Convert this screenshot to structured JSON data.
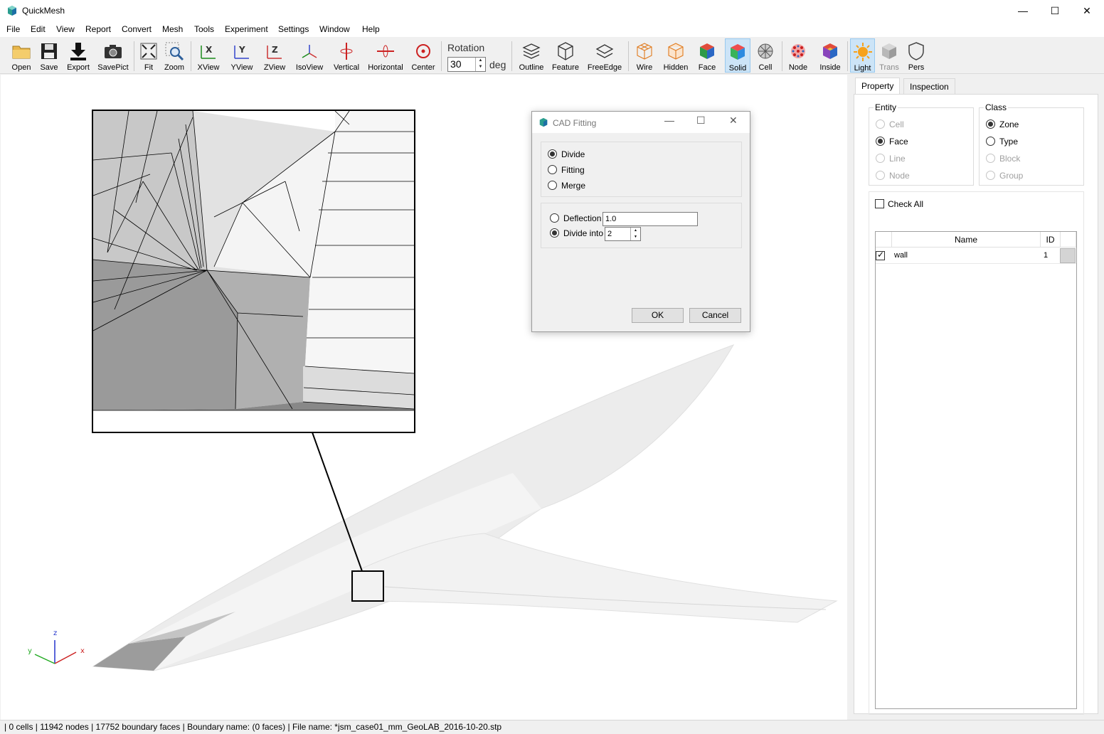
{
  "app": {
    "title": "QuickMesh"
  },
  "menu": [
    "File",
    "Edit",
    "View",
    "Report",
    "Convert",
    "Mesh",
    "Tools",
    "Experiment",
    "Settings",
    "Window",
    "Help"
  ],
  "toolbar": {
    "open": "Open",
    "save": "Save",
    "export": "Export",
    "savepict": "SavePict",
    "fit": "Fit",
    "zoom": "Zoom",
    "xview": "XView",
    "yview": "YView",
    "zview": "ZView",
    "isoview": "IsoView",
    "vertical": "Vertical",
    "horizontal": "Horizontal",
    "center": "Center",
    "rotation_label": "Rotation",
    "rotation_value": "30",
    "rotation_unit": "deg",
    "outline": "Outline",
    "feature": "Feature",
    "freeedge": "FreeEdge",
    "wire": "Wire",
    "hidden": "Hidden",
    "face": "Face",
    "solid": "Solid",
    "cell": "Cell",
    "node": "Node",
    "inside": "Inside",
    "light": "Light",
    "trans": "Trans",
    "pers": "Pers"
  },
  "axes": {
    "x": "x",
    "y": "y",
    "z": "z"
  },
  "dialog": {
    "title": "CAD Fitting",
    "modes": [
      "Divide",
      "Fitting",
      "Merge"
    ],
    "selected_mode": "Divide",
    "deflection_label": "Deflection",
    "deflection_value": "1.0",
    "divide_label": "Divide into",
    "divide_value": "2",
    "ok": "OK",
    "cancel": "Cancel"
  },
  "panel": {
    "tabs": [
      "Property",
      "Inspection"
    ],
    "entity_title": "Entity",
    "entity_options": [
      "Cell",
      "Face",
      "Line",
      "Node"
    ],
    "entity_selected": "Face",
    "class_title": "Class",
    "class_options": [
      "Zone",
      "Type",
      "Block",
      "Group"
    ],
    "class_selected": "Zone",
    "check_all": "Check All",
    "columns": [
      "Name",
      "ID"
    ],
    "rows": [
      {
        "checked": true,
        "name": "wall",
        "id": "1"
      }
    ]
  },
  "status": {
    "text": "| 0 cells | 11942 nodes | 17752 boundary faces |  Boundary name:  (0 faces) | File name: *jsm_case01_mm_GeoLAB_2016-10-20.stp"
  }
}
